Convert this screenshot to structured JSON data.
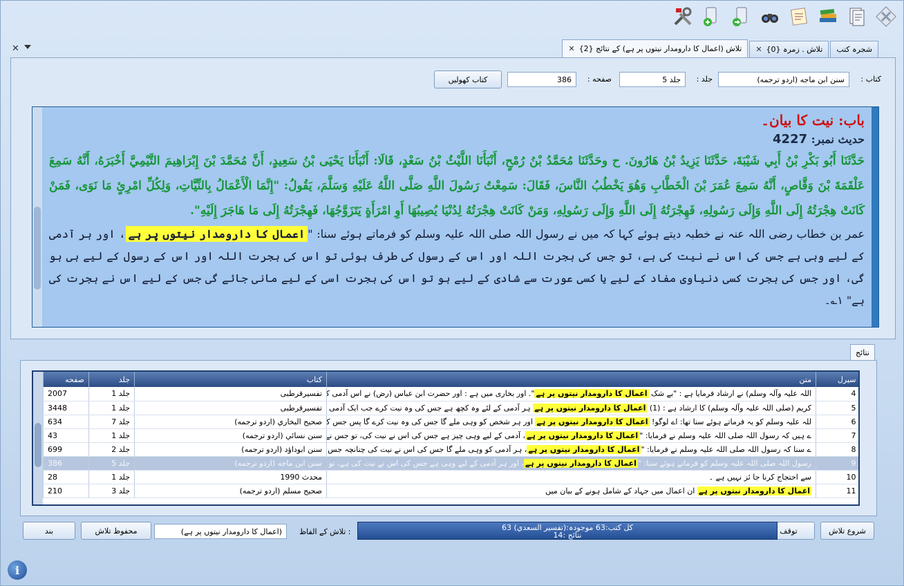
{
  "toolbar": {
    "buttons": [
      "settings-icon",
      "add-book-icon",
      "next-book-icon",
      "binoculars-icon",
      "notes-icon",
      "books-icon",
      "pages-icon",
      "close-tools-icon"
    ]
  },
  "tabs": [
    {
      "label": "شجرہ کتب",
      "close": ""
    },
    {
      "label": "تلاش . زمرہ {0}",
      "close": "✕"
    },
    {
      "label": "تلاش (اعمال کا دارومدار نیتوں پر ہے) کے نتائج {2}",
      "close": "✕"
    }
  ],
  "form": {
    "book_label": "کتاب :",
    "book_value": "سنن ابن ماجه (اردو ترجمه)",
    "volume_label": "جلد :",
    "volume_value": "جلد 5",
    "page_label": "صفحه :",
    "page_value": "386",
    "open_button": "کتاب کھولیں"
  },
  "reader": {
    "bab": "باب: نیت کا بیان۔",
    "hadith_label": "حدیث نمبر:",
    "hadith_number": "4227",
    "arabic": "حَدَّثَنَا أَبُو بَكْرِ بْنُ أَبِي شَيْبَةَ، حَدَّثَنَا يَزِيدُ بْنُ هَارُونَ. ح وحَدَّثَنَا مُحَمَّدُ بْنُ رُمْحٍ، أَنْبَأَنَا اللَّيْثُ بْنُ سَعْدٍ، قَالَا: أَنْبَأَنَا يَحْيَى بْنُ سَعِيدٍ، أَنَّ مُحَمَّدَ بْنَ إِبْرَاهِيمَ التَّيْمِيَّ أَخْبَرَهُ، أَنَّهُ سَمِعَ عَلْقَمَةَ بْنَ وَقَّاصٍ، أَنَّهُ سَمِعَ عُمَرَ بْنَ الْخَطَّابِ وَهُوَ يَخْطُبُ النَّاسَ، فَقَالَ: سَمِعْتُ رَسُولَ اللَّهِ صَلَّى اللَّهُ عَلَيْهِ وَسَلَّمَ، يَقُولُ: \"إِنَّمَا الْأَعْمَالُ بِالنِّيَّاتِ، وَلِكُلِّ امْرِئٍ مَا نَوَى، فَمَنْ كَانَتْ هِجْرَتُهُ إِلَى اللَّهِ وَإِلَى رَسُولِهِ، فَهِجْرَتُهُ إِلَى اللَّهِ وَإِلَى رَسُولِهِ، وَمَنْ كَانَتْ هِجْرَتُهُ لِدُنْيَا يُصِيبُهَا أَوِ امْرَأَةٍ يَتَزَوَّجُهَا، فَهِجْرَتُهُ إِلَى مَا هَاجَرَ إِلَيْهِ\".",
    "urdu_before": "عمر بن خطاب رضی اللہ عنہ نے خطبہ دیتے ہوئے کہا کہ میں نے رسول اللہ صلی اللہ علیہ وسلم کو فرماتے ہوئے سنا: \"",
    "urdu_highlight": "اعمال کا دارومدار نیتوں پر ہے",
    "urdu_after": "، اور ہر آدمی کے لیے وہی ہے جس کی اس نے نیت کی ہے، تو جس کی ہجرت اللہ اور اس کے رسول کی طرف ہوئی تو اس کی ہجرت اللہ اور اس کے رسول کے لیے ہی ہو گی، اور جس کی ہجرت کسی دنیاوی مفاد کے لیے یا کسی عورت سے شادی کے لیے ہو تو اس کی ہجرت اسی کے لیے مانی جائے گی جس کے لیے اس نے ہجرت کی ہے\" ۱؎۔"
  },
  "results": {
    "tab_label": "نتائج",
    "columns": [
      "سیرل",
      "متن",
      "کتاب",
      "جلد",
      "صفحه"
    ],
    "keyword": "اعمال کا دارومدار نیتوں پر ہے",
    "rows": [
      {
        "serial": "4",
        "pre": "اللہ علیہ وآلہ وسلم) نے ارشاد فرمایا ہے : \"بے شک ",
        "kw": "اعمال کا دارومدار نیتوں پر ہے",
        "post": "\". اور بخاری میں ہے : اور حضرت ابن عباس (رض) نے اس آدمی کے بارے میں کہہ..",
        "book": "تفسیرقرطبی",
        "volume": "جلد 1",
        "page": "2007",
        "selected": false
      },
      {
        "serial": "5",
        "pre": "کریم (صلی اللہ علیہ وآلہ وسلم) کا ارشاد ہے : (1) ",
        "kw": "اعمال کا دارومدار نیتوں پر ہے",
        "post": " ہر آدمی کے لئے وہ کچھ ہے جس کی وہ نیت کرے جب ایک آدمی اپنے بیم کے ساتھ..",
        "book": "تفسیرقرطبی",
        "volume": "جلد 1",
        "page": "3448",
        "selected": false
      },
      {
        "serial": "6",
        "pre": "للہ علیہ وسلم کو یہ فرماتے ہوئے سنا تھا: اے لوگو! ",
        "kw": "اعمال کا دارومدار نیتوں پر ہے",
        "post": " اور ہر شخص کو وہی ملے گا جس کی وہ نیت کرے گا پس جس کی ہجرت اللہ اور اس..",
        "book": "صحيح البخاري (اردو ترجمه)",
        "volume": "جلد 7",
        "page": "634",
        "selected": false
      },
      {
        "serial": "7",
        "pre": "ے ہیں کہ رسول اللہ صلی اللہ علیہ وسلم نے فرمایا: \"",
        "kw": "اعمال کا دارومدار نیتوں پر ہے",
        "post": "، آدمی کے لیے وہی چیز ہے جس کی اس نے نیت کی، تو جس نے اللہ اور اس کے ر..",
        "book": "سنن نسائي (اردو ترجمه)",
        "volume": "جلد 1",
        "page": "43",
        "selected": false
      },
      {
        "serial": "8",
        "pre": "ے سنا کہ رسول اللہ صلی اللہ علیہ وسلم نے فرمایا: \"",
        "kw": "اعمال کا دارومدار نیتوں پر ہے",
        "post": "، ہر آدمی کو وہی ملے گا جس کی اس نے نیت کی چنانچہ جس کی ہجرت اللہ اور اس..",
        "book": "سنن ابوداؤد (اردو ترجمه)",
        "volume": "جلد 2",
        "page": "699",
        "selected": false
      },
      {
        "serial": "9",
        "pre": "رسول اللہ صلی اللہ علیہ وسلم کو فرماتے ہوئے سنا: \"",
        "kw": "اعمال کا دارومدار نیتوں پر ہے",
        "post": "، اور ہر آدمی کے لیے وہی ہے جس کی اس نے نیت کی ہے، تو جس کی ہجرت اللہ ..",
        "book": "سنن ابن ماجه (اردو ترجمه)",
        "volume": "جلد 5",
        "page": "386",
        "selected": true
      },
      {
        "serial": "10",
        "pre": "سے احتجاج کرنا جا ئز نہیں ہے ۔",
        "kw": "",
        "post": "",
        "book": "محدث 1990",
        "volume": "جلد 1",
        "page": "28",
        "selected": false
      },
      {
        "serial": "11",
        "pre": "",
        "kw": "اعمال کا دارومدار نیتوں پر ہے",
        "post": " ان اعمال میں جہاد کے شامل ہونے کے بیان میں",
        "book": "صحيح مسلم (اردو ترجمه)",
        "volume": "جلد 3",
        "page": "210",
        "selected": false
      }
    ]
  },
  "bottom": {
    "start_search": "شروع تلاش",
    "stop": "توقف",
    "status_line1": "کل کتب:63   موجودہ:(تفسير السعدي) 63",
    "status_line2": "نتائج :14",
    "search_words_label": "تلاش کے الفاظ :",
    "search_words_value": "(اعمال کا دارومدار نیتوں پر ہے)",
    "saved_search": "محفوظ تلاش",
    "close": "بند"
  }
}
